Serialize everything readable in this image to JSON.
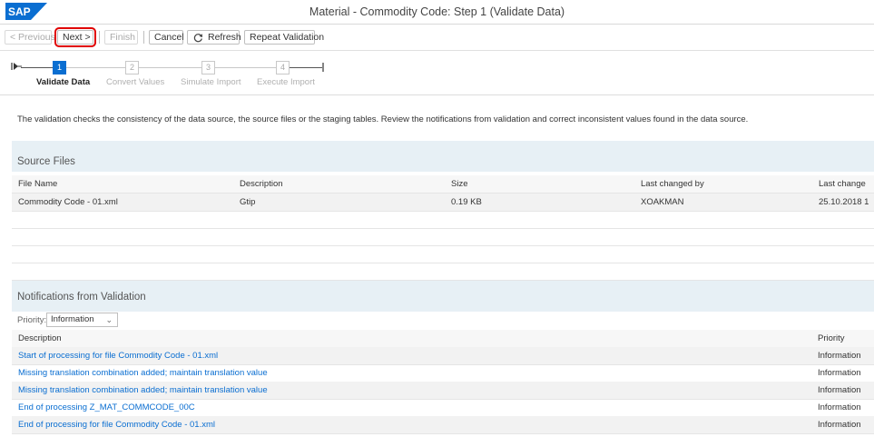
{
  "app": {
    "logo_text": "SAP",
    "title": "Material - Commodity Code: Step 1  (Validate Data)"
  },
  "toolbar": {
    "previous": "< Previous",
    "next": "Next >",
    "finish": "Finish",
    "cancel": "Cancel",
    "refresh": "Refresh",
    "repeat_validation": "Repeat Validation"
  },
  "wizard": {
    "steps": [
      {
        "number": "1",
        "label": "Validate Data",
        "active": true
      },
      {
        "number": "2",
        "label": "Convert Values",
        "active": false
      },
      {
        "number": "3",
        "label": "Simulate Import",
        "active": false
      },
      {
        "number": "4",
        "label": "Execute Import",
        "active": false
      }
    ]
  },
  "intro_text": "The validation checks the consistency of the data source, the source files or the staging tables. Review the notifications from validation and correct inconsistent values found in the data source.",
  "source_files": {
    "title": "Source Files",
    "columns": [
      "File Name",
      "Description",
      "Size",
      "Last changed by",
      "Last change"
    ],
    "rows": [
      [
        "Commodity Code - 01.xml",
        "Gtip",
        "0.19 KB",
        "XOAKMAN",
        "25.10.2018 1"
      ]
    ]
  },
  "notifications": {
    "title": "Notifications from Validation",
    "priority_label": "Priority:",
    "priority_value": "Information",
    "columns": [
      "Description",
      "Priority"
    ],
    "rows": [
      [
        "Start of processing for file Commodity Code - 01.xml",
        "Information"
      ],
      [
        "Missing translation combination added; maintain translation value",
        "Information"
      ],
      [
        "Missing translation combination added; maintain translation value",
        "Information"
      ],
      [
        "End of processing Z_MAT_COMMCODE_00C",
        "Information"
      ],
      [
        "End of processing for file Commodity Code - 01.xml",
        "Information"
      ]
    ]
  },
  "colors": {
    "accent": "#0a6ed1",
    "highlight": "#e00000"
  }
}
